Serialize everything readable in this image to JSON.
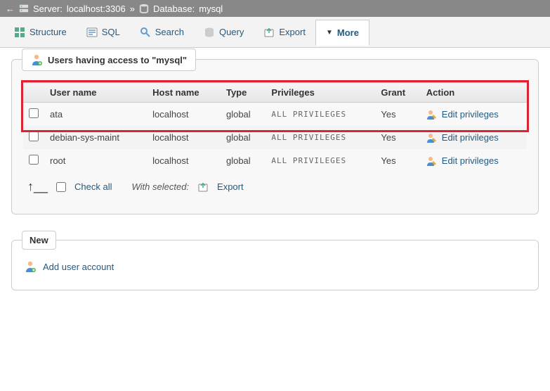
{
  "breadcrumb": {
    "server_label": "Server:",
    "server_value": "localhost:3306",
    "db_label": "Database:",
    "db_value": "mysql"
  },
  "tabs": {
    "structure": "Structure",
    "sql": "SQL",
    "search": "Search",
    "query": "Query",
    "export": "Export",
    "more": "More"
  },
  "panel_title_prefix": "Users having access to \"",
  "panel_title_db": "mysql",
  "panel_title_suffix": "\"",
  "columns": {
    "user": "User name",
    "host": "Host name",
    "type": "Type",
    "priv": "Privileges",
    "grant": "Grant",
    "action": "Action"
  },
  "rows": [
    {
      "user": "ata",
      "host": "localhost",
      "type": "global",
      "priv": "ALL PRIVILEGES",
      "grant": "Yes",
      "action": "Edit privileges"
    },
    {
      "user": "debian-sys-maint",
      "host": "localhost",
      "type": "global",
      "priv": "ALL PRIVILEGES",
      "grant": "Yes",
      "action": "Edit privileges"
    },
    {
      "user": "root",
      "host": "localhost",
      "type": "global",
      "priv": "ALL PRIVILEGES",
      "grant": "Yes",
      "action": "Edit privileges"
    }
  ],
  "footer": {
    "check_all": "Check all",
    "with_selected": "With selected:",
    "export": "Export"
  },
  "new_panel": {
    "title": "New",
    "add_user": "Add user account"
  }
}
